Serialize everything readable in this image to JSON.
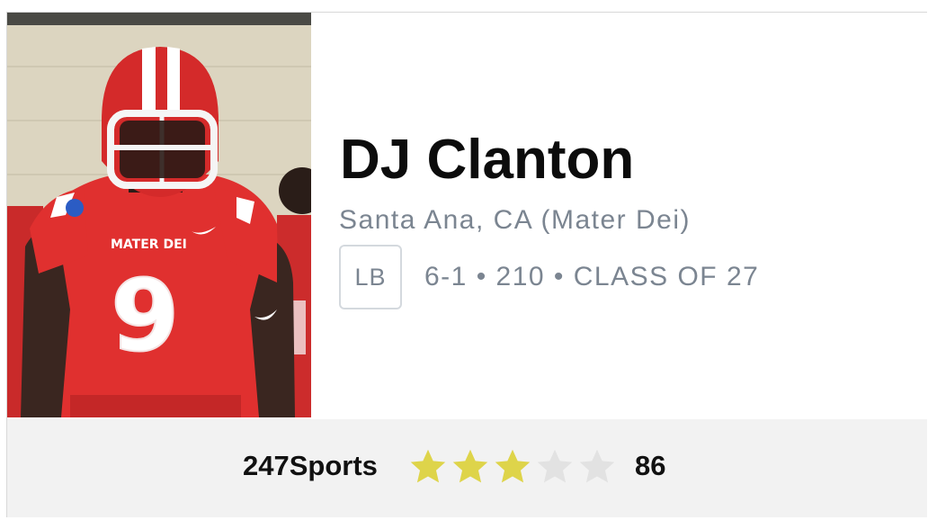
{
  "player": {
    "name": "DJ Clanton",
    "hometown": "Santa Ana, CA (Mater Dei)",
    "position": "LB",
    "vitals": "6-1 • 210 • CLASS OF 27",
    "jersey_number": "9",
    "jersey_text": "MATER DEI"
  },
  "rating": {
    "source": "247Sports",
    "stars_filled": 3,
    "stars_total": 5,
    "score": "86"
  },
  "colors": {
    "star_filled": "#ded44a",
    "star_empty": "#e2e2e2",
    "jersey_red": "#e0302f"
  }
}
